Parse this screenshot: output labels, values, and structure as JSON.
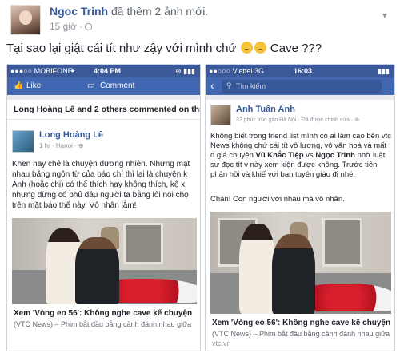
{
  "post": {
    "author": "Ngoc Trinh",
    "action": "đã thêm 2 ảnh mới.",
    "time": "15 giờ ·",
    "status_text": "Tại sao lại giật cái tít như zậy với mình chứ",
    "status_suffix": "Cave ???"
  },
  "left_shot": {
    "carrier": "●●●○○ MOBIFONE",
    "wifi": "✦",
    "time": "4:04 PM",
    "battery": "⊕ ▮▮▮",
    "like_label": "Like",
    "comment_label": "Comment",
    "commented": "Long Hoàng Lê and 2 others commented on this.",
    "commenter": "Long Hoàng Lê",
    "comment_meta": "1 hr · Hanoi · ⊕",
    "body": "Khen hay chê là chuyện đương nhiên. Nhưng mạt nhau bằng ngôn từ của báo chí thì lại là chuyện k Anh (hoặc chị) có thể thích hay không thích, kệ x nhưng đừng có phủ đầu người ta bằng lối nói chọ trên mặt báo thế này. Vô nhân lắm!",
    "link_title": "Xem 'Vòng eo 56': Không nghe cave kể chuyện",
    "link_sub": "(VTC News) – Phim bắt đầu bằng cảnh đánh nhau giữa"
  },
  "right_shot": {
    "carrier": "●●○○○ Viettel  3G",
    "time": "16:03",
    "battery": "▮▮▮",
    "back": "‹",
    "search_placeholder": "Tìm kiếm",
    "poster": "Anh Tuấn Anh",
    "poster_meta": "32 phúc trúc gần Hà Nội · Đã được chỉnh sửa · ⊕",
    "body1": "Không biết trong friend list mình có ai làm cao bên vtc News không chứ cái tít vô lương, vô văn hoá và mất d giá chuyện",
    "tag1": "Vũ Khắc Tiệp",
    "vs": "vs",
    "tag2": "Ngọc Trinh",
    "body2": "nhờ luật sư đọc tít v này xem kiện được không. Trước tiên phản hồi và khiế với ban tuyên giáo đi nhé.",
    "body3": "Chán! Con người với nhau mà vô nhân.",
    "link_title": "Xem 'Vòng eo 56': Không nghe cave kể chuyện",
    "link_sub": "(VTC News) – Phim bắt đầu bằng cảnh đánh nhau giữa",
    "link_domain": "vtc.vn"
  }
}
